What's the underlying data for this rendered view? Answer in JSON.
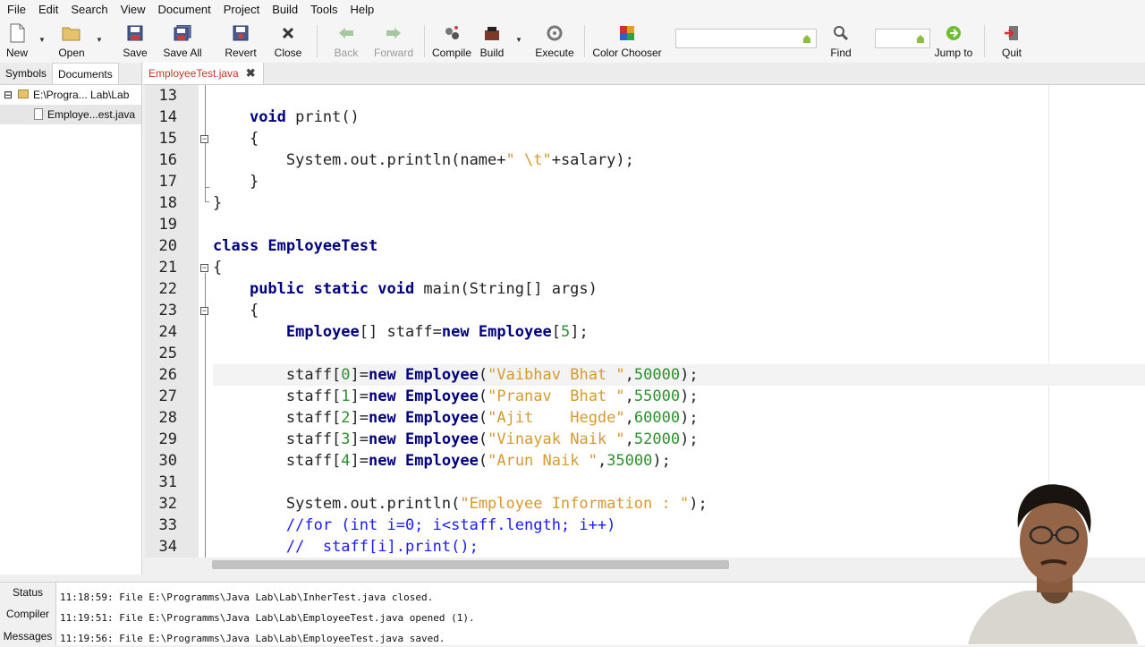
{
  "menu": [
    "File",
    "Edit",
    "Search",
    "View",
    "Document",
    "Project",
    "Build",
    "Tools",
    "Help"
  ],
  "toolbar": {
    "new": "New",
    "open": "Open",
    "save": "Save",
    "save_all": "Save All",
    "revert": "Revert",
    "close": "Close",
    "back": "Back",
    "forward": "Forward",
    "compile": "Compile",
    "build": "Build",
    "execute": "Execute",
    "color_chooser": "Color Chooser",
    "find": "Find",
    "jump_to": "Jump to",
    "quit": "Quit",
    "search_value": "",
    "line_value": ""
  },
  "sidebar": {
    "tabs": [
      "Symbols",
      "Documents"
    ],
    "active_tab": "Documents",
    "folder": "E:\\Progra... Lab\\Lab",
    "file": "Employe...est.java"
  },
  "editor": {
    "tab_name": "EmployeeTest.java",
    "line_numbers": [
      "13",
      "14",
      "15",
      "16",
      "17",
      "18",
      "19",
      "20",
      "21",
      "22",
      "23",
      "24",
      "25",
      "26",
      "27",
      "28",
      "29",
      "30",
      "31",
      "32",
      "33",
      "34"
    ]
  },
  "messages": {
    "tabs": [
      "Status",
      "Compiler",
      "Messages"
    ],
    "lines": [
      "11:18:59: File E:\\Programms\\Java Lab\\Lab\\InherTest.java closed.",
      "11:19:51: File E:\\Programms\\Java Lab\\Lab\\EmployeeTest.java opened (1).",
      "11:19:56: File E:\\Programms\\Java Lab\\Lab\\EmployeeTest.java saved."
    ]
  },
  "colors": {
    "keyword": "#00007f",
    "string": "#d69a2e",
    "number": "#2f8f2f",
    "comment": "#1a1aff",
    "tab_name": "#c0392b"
  },
  "icons": [
    "new-file-icon",
    "open-folder-icon",
    "save-icon",
    "save-all-icon",
    "revert-icon",
    "close-icon",
    "back-arrow-icon",
    "forward-arrow-icon",
    "compile-icon",
    "build-icon",
    "execute-icon",
    "color-chooser-icon",
    "find-icon",
    "jump-to-icon",
    "quit-icon"
  ]
}
